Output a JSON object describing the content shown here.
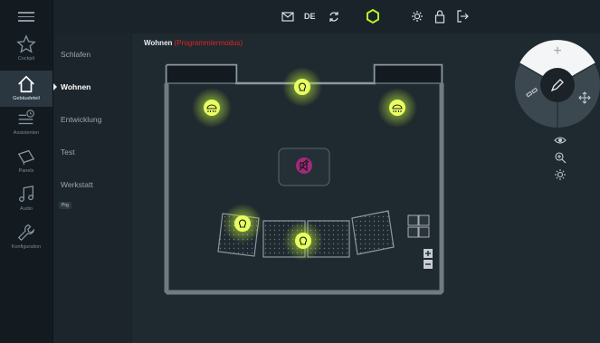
{
  "rail": {
    "items": [
      {
        "label": "Cockpit",
        "icon": "star-icon"
      },
      {
        "label": "Gebäudeteil",
        "icon": "home-icon",
        "active": true
      },
      {
        "label": "Assistenten",
        "icon": "assistant-clock-icon"
      },
      {
        "label": "Panels",
        "icon": "panels-icon"
      },
      {
        "label": "Audio",
        "icon": "music-note-icon"
      },
      {
        "label": "Konfiguration",
        "icon": "wrench-icon"
      }
    ]
  },
  "topbar": {
    "language": "DE",
    "icons": [
      "mail-icon",
      "sync-icon",
      "connection-status-icon",
      "sun-icon",
      "lock-icon",
      "logout-icon"
    ],
    "accent": "#b8f02a"
  },
  "rooms": {
    "items": [
      "Schlafen",
      "Wohnen",
      "Entwicklung",
      "Test",
      "Werkstatt"
    ],
    "active": "Wohnen",
    "pg_badge": "Prg"
  },
  "main": {
    "title": "Wohnen",
    "mode": "(Programmiermodus)",
    "mode_color": "#e02424"
  },
  "dial": {
    "top_glyph": "+",
    "center_icon": "pencil-icon",
    "left_icon": "link-icon",
    "right_icon": "move-arrows-icon"
  },
  "side_tools": [
    "eye-icon",
    "zoom-in-icon",
    "brightness-icon"
  ],
  "zoom": {
    "plus": "+",
    "minus": "−"
  },
  "colors": {
    "glow": "#c8f33a",
    "speaker": "#a0297a"
  }
}
